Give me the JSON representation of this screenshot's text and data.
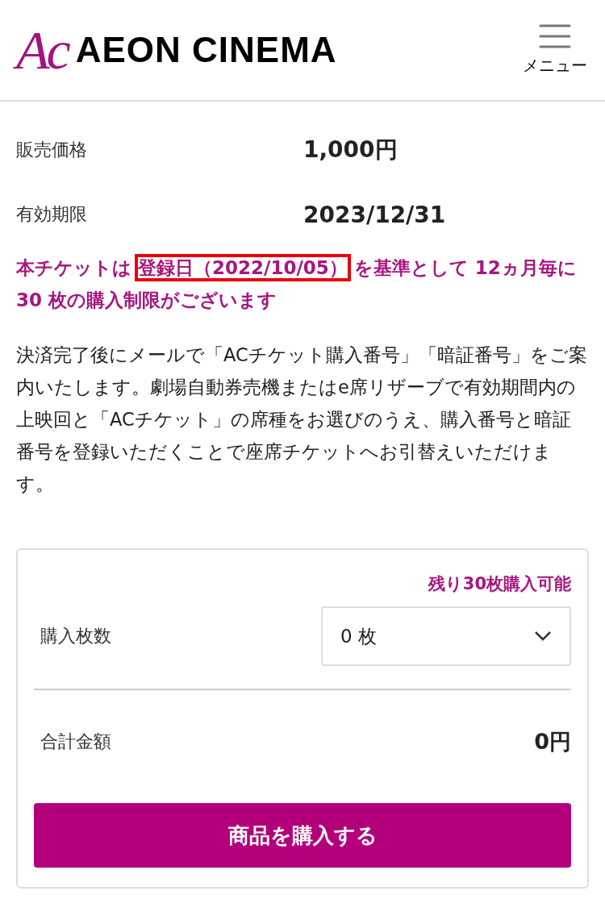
{
  "header": {
    "logo_mark": "Ac",
    "logo_text": "AEON CINEMA",
    "menu_label": "メニュー"
  },
  "details": [
    {
      "label": "販売価格",
      "value": "1,000円"
    },
    {
      "label": "有効期限",
      "value": "2023/12/31"
    }
  ],
  "notice": {
    "before": "本チケットは",
    "highlight": "登録日（2022/10/05）",
    "after": " を基準として 12ヵ月毎に 30 枚の購入制限がございます"
  },
  "description": "決済完了後にメールで「ACチケット購入番号」「暗証番号」をご案内いたします。劇場自動券売機またはe席リザーブで有効期間内の上映回と「ACチケット」の席種をお選びのうえ、購入番号と暗証番号を登録いただくことで座席チケットへお引替えいただけます。",
  "purchase": {
    "remaining": "残り30枚購入可能",
    "quantity_label": "購入枚数",
    "quantity_value": "0 枚",
    "total_label": "合計金額",
    "total_value": "0円",
    "buy_button": "商品を購入する"
  }
}
